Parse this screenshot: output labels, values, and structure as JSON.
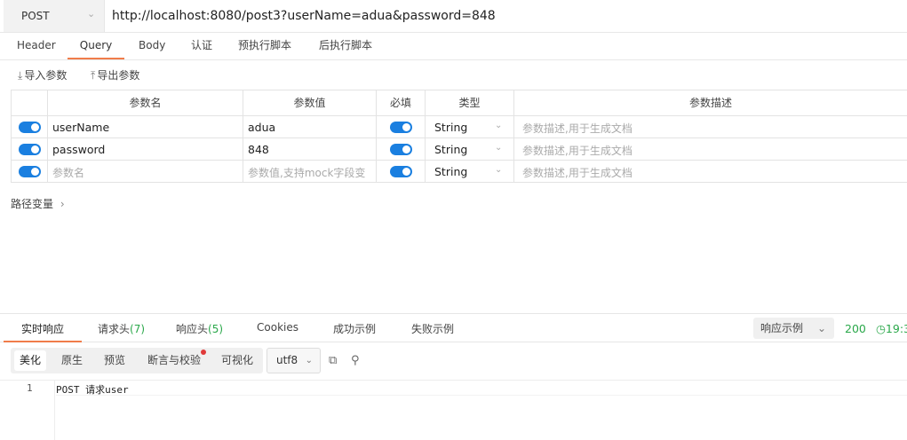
{
  "request": {
    "method": "POST",
    "url": "http://localhost:8080/post3?userName=adua&password=848"
  },
  "req_tabs": [
    "Header",
    "Query",
    "Body",
    "认证",
    "预执行脚本",
    "后执行脚本"
  ],
  "active_req_tab": "Query",
  "actions": {
    "import": "导入参数",
    "export": "导出参数"
  },
  "params_table": {
    "headers": [
      "参数名",
      "参数值",
      "必填",
      "类型",
      "参数描述"
    ],
    "rows": [
      {
        "name": "userName",
        "value": "adua",
        "type": "String",
        "desc": "参数描述,用于生成文档",
        "enabled": true,
        "required": true
      },
      {
        "name": "password",
        "value": "848",
        "type": "String",
        "desc": "参数描述,用于生成文档",
        "enabled": true,
        "required": true
      },
      {
        "name": "参数名",
        "value": "参数值,支持mock字段变",
        "type": "String",
        "desc": "参数描述,用于生成文档",
        "enabled": true,
        "required": true,
        "placeholder": true
      }
    ]
  },
  "path_vars_label": "路径变量",
  "response": {
    "tabs": [
      {
        "label": "实时响应"
      },
      {
        "label": "请求头",
        "count": "(7)"
      },
      {
        "label": "响应头",
        "count": "(5)"
      },
      {
        "label": "Cookies"
      },
      {
        "label": "成功示例"
      },
      {
        "label": "失败示例"
      }
    ],
    "example_label": "响应示例",
    "status": "200",
    "time": "19:3",
    "format_buttons": [
      "美化",
      "原生",
      "预览",
      "断言与校验",
      "可视化"
    ],
    "encoding": "utf8",
    "line_number": "1",
    "body": "POST 请求user"
  },
  "colors": {
    "accent": "#f07c4a",
    "toggle": "#1a7fe0",
    "success": "#2aa84a"
  }
}
